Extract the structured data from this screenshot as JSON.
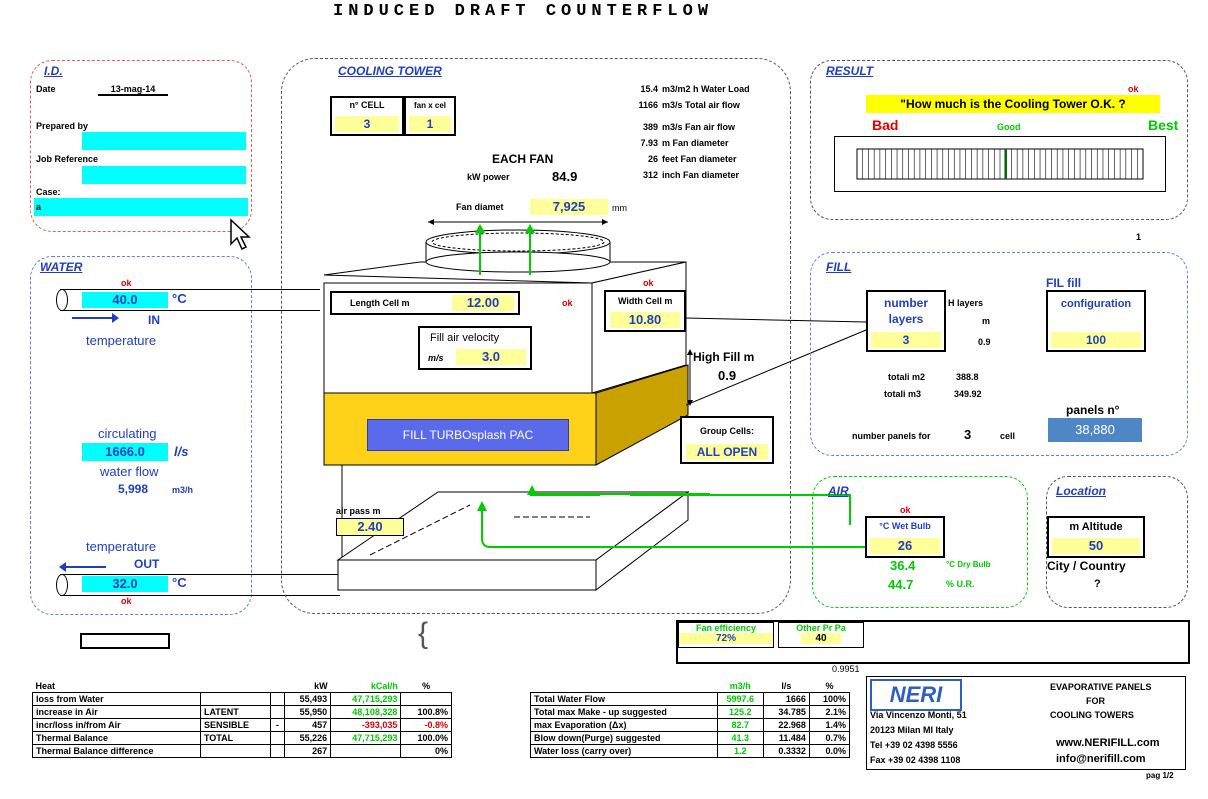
{
  "title": "INDUCED   DRAFT   COUNTERFLOW",
  "id": {
    "label": "I.D.",
    "date_label": "Date",
    "date_value": "13-mag-14",
    "prepared_label": "Prepared by",
    "job_label": "Job Reference",
    "case_label": "Case:",
    "case_value": "a"
  },
  "water": {
    "label": "WATER",
    "ok_in": "ok",
    "in_value": "40.0",
    "in_unit": "°C",
    "in_label": "IN",
    "in_temp_label": "temperature",
    "circ_label": "circulating",
    "circ_value": "1666.0",
    "circ_unit": "l/s",
    "flow_label": "water flow",
    "flow_value": "5,998",
    "flow_unit": "m3/h",
    "out_temp_label": "temperature",
    "out_label": "OUT",
    "out_value": "32.0",
    "out_unit": "°C",
    "ok_out": "ok"
  },
  "tower": {
    "label": "COOLING TOWER",
    "cell_label": "n° CELL",
    "cell_value": "3",
    "fan_label": "fan x cel",
    "fan_value": "1",
    "each_fan": "EACH FAN",
    "kw_label": "kW power",
    "kw_value": "84.9",
    "fan_diam_label": "Fan diamet",
    "fan_diam_value": "7,925",
    "fan_diam_unit": "mm",
    "length_label": "Length Cell m",
    "length_value": "12.00",
    "ok_len": "ok",
    "ok_width": "ok",
    "width_label": "Width Cell m",
    "width_value": "10.80",
    "velocity_label": "Fill air velocity",
    "velocity_unit": "m/s",
    "velocity_value": "3.0",
    "high_fill_label": "High Fill m",
    "high_fill_value": "0.9",
    "fill_name": "FILL TURBOsplash PAC",
    "group_label": "Group Cells:",
    "group_value": "ALL OPEN",
    "air_pass_label": "air pass m",
    "air_pass_value": "2.40",
    "stats": [
      {
        "v": "15.4",
        "t": "m3/m2 h Water Load"
      },
      {
        "v": "1166",
        "t": "m3/s Total air flow"
      },
      {
        "v": "389",
        "t": "m3/s  Fan air flow"
      },
      {
        "v": "7.93",
        "t": "m   Fan diameter"
      },
      {
        "v": "26",
        "t": "feet   Fan diameter"
      },
      {
        "v": "312",
        "t": "inch  Fan diameter"
      }
    ]
  },
  "result": {
    "label": "RESULT",
    "ok": "ok",
    "question": "\"How much is the Cooling Tower O.K. ?",
    "bad": "Bad",
    "good": "Good",
    "best": "Best",
    "score": 0.52,
    "page_num": "1"
  },
  "fill": {
    "label": "FILL",
    "layers_label": "number layers",
    "layers_value": "3",
    "h_layers": "H layers",
    "h_unit": "m",
    "h_value": "0.9",
    "fil_fill": "FIL fill",
    "config_label": "configuration",
    "config_value": "100",
    "totalm2_label": "totali m2",
    "totalm2_value": "388.8",
    "totalm3_label": "totali m3",
    "totalm3_value": "349.92",
    "panels_label": "panels n°",
    "panels_value": "38,880",
    "panels_for_label": "number panels for",
    "panels_for_value": "3",
    "panels_for_unit": "cell"
  },
  "air": {
    "label": "AIR",
    "ok": "ok",
    "wet_label": "°C Wet Bulb",
    "wet_value": "26",
    "dry_value": "36.4",
    "dry_label": "°C Dry Bulb",
    "ur_value": "44.7",
    "ur_label": "% U.R."
  },
  "location": {
    "label": "Location",
    "alt_label": "m  Altitude",
    "alt_value": "50",
    "city_label": "City / Country",
    "city_value": "?"
  },
  "efficiency": {
    "fan_eff_label": "Fan efficiency",
    "fan_eff_value": "72%",
    "other_label": "Other Pr Pa",
    "other_value": "40",
    "small_value": "0.9951"
  },
  "heat": {
    "header": [
      "Heat",
      "",
      "",
      "kW",
      "kCal/h",
      "%"
    ],
    "rows": [
      [
        "loss from Water",
        "",
        "",
        "55,493",
        "47,715,293",
        ""
      ],
      [
        "increase in Air",
        "LATENT",
        "",
        "55,950",
        "48,108,328",
        "100.8%"
      ],
      [
        "incr/loss in/from  Air",
        "SENSIBLE",
        "-",
        "457",
        "-393,035",
        "-0.8%"
      ],
      [
        "Thermal Balance",
        "TOTAL",
        "",
        "55,226",
        "47,715,293",
        "100.0%"
      ],
      [
        "Thermal Balance difference",
        "",
        "",
        "267",
        "",
        "0%"
      ]
    ]
  },
  "waterflows": {
    "header": [
      "",
      "m3/h",
      "l/s",
      "%"
    ],
    "rows": [
      [
        "Total Water Flow",
        "5997.6",
        "1666",
        "100%"
      ],
      [
        "Total max Make - up suggested",
        "125.2",
        "34.785",
        "2.1%"
      ],
      [
        "max Evaporation (Δx)",
        "82.7",
        "22.968",
        "1.4%"
      ],
      [
        "Blow down(Purge) suggested",
        "41.3",
        "11.484",
        "0.7%"
      ],
      [
        "Water loss (carry over)",
        "1.2",
        "0.3332",
        "0.0%"
      ]
    ]
  },
  "company": {
    "logo": "NERI",
    "addr1": "Via Vincenzo Monti, 51",
    "addr2": "20123 Milan MI Italy",
    "tel": "Tel +39 02 4398 5556",
    "fax": "Fax +39 02 4398 1108",
    "line1": "EVAPORATIVE PANELS",
    "line2": "FOR",
    "line3": "COOLING TOWERS",
    "web": "www.NERIFILL.com",
    "email": "info@nerifill.com",
    "page": "pag 1/2"
  }
}
